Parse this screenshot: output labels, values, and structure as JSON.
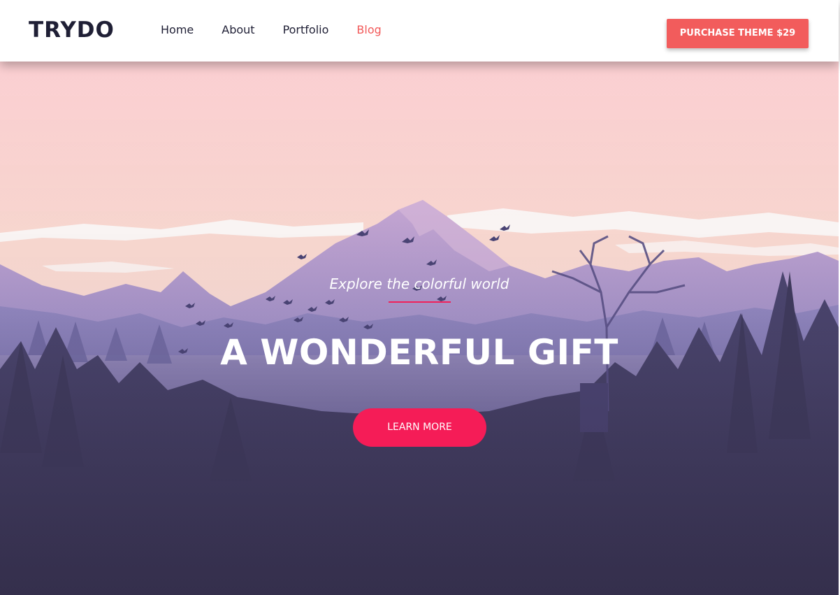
{
  "header": {
    "logo": "TRYDO",
    "nav": [
      {
        "label": "Home",
        "active": false
      },
      {
        "label": "About",
        "active": false
      },
      {
        "label": "Portfolio",
        "active": false
      },
      {
        "label": "Blog",
        "active": true
      }
    ],
    "purchase_label": "PURCHASE THEME $29"
  },
  "hero": {
    "subtitle": "Explore the colorful world",
    "title": "A WONDERFUL GIFT",
    "cta_label": "LEARN MORE"
  },
  "colors": {
    "brand_text": "#1f1f35",
    "accent_coral": "#f25c5c",
    "accent_pink": "#f51c57",
    "sky_top": "#fcd2d3",
    "mountain": "#a796c8",
    "forest_dark": "#3d3856"
  }
}
